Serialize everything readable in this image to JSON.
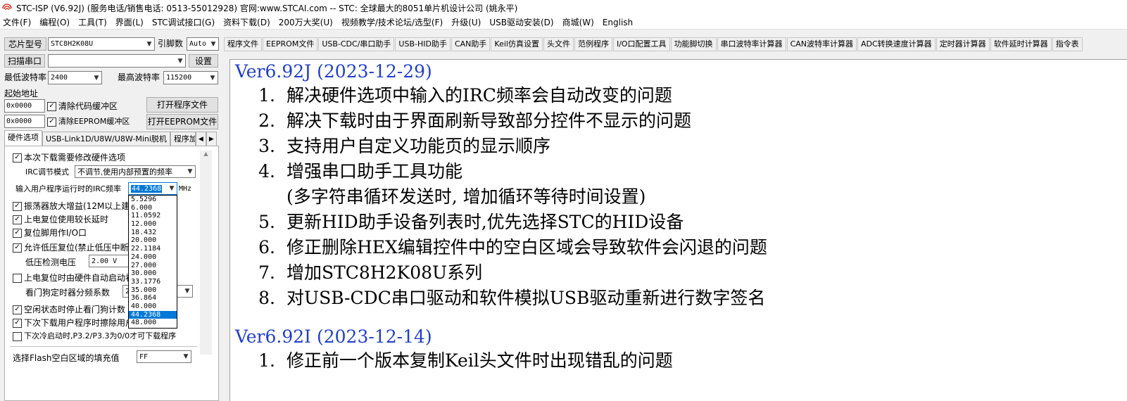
{
  "window": {
    "title": "STC-ISP (V6.92J) (服务电话/销售电话: 0513-55012928) 官网:www.STCAI.com  -- STC: 全球最大的8051单片机设计公司 (姚永平)"
  },
  "menu": [
    "文件(F)",
    "编程(O)",
    "工具(T)",
    "界面(L)",
    "STC调试接口(G)",
    "资料下载(D)",
    "200万大奖(U)",
    "视频教学/技术论坛/选型(F)",
    "升级(U)",
    "USB驱动安装(D)",
    "商城(W)",
    "English"
  ],
  "left": {
    "chip_model_btn": "芯片型号",
    "chip_model": "STC8H2K08U",
    "pin_count_label": "引脚数",
    "pin_count": "Auto",
    "scan_port_btn": "扫描串口",
    "port_value": "",
    "settings_btn": "设置",
    "min_baud_label": "最低波特率",
    "min_baud": "2400",
    "max_baud_label": "最高波特率",
    "max_baud": "115200",
    "start_addr_label": "起始地址",
    "code_addr": "0x0000",
    "clear_code_label": "清除代码缓冲区",
    "open_program_btn": "打开程序文件",
    "eeprom_addr": "0x0000",
    "clear_eeprom_label": "清除EEPROM缓冲区",
    "open_eeprom_btn": "打开EEPROM文件",
    "tabs": [
      "硬件选项",
      "USB-Link1D/U8W/U8W-Mini脱机",
      "程序加"
    ],
    "hw": {
      "modify_hw": "本次下载需要修改硬件选项",
      "irc_mode_label": "IRC调节模式",
      "irc_mode": "不调节,使用内部预置的频率",
      "irc_freq_label": "输入用户程序运行时的IRC频率",
      "irc_freq": "44.2368",
      "irc_unit": "MHz",
      "osc_gain": "振荡器放大增益(12M以上建议",
      "power_on_delay": "上电复位使用较长延时",
      "reset_pin_io": "复位脚用作I/O口",
      "low_volt_reset": "允许低压复位(禁止低压中断",
      "low_volt_label": "低压检测电压",
      "low_volt": "2.00 V",
      "wdt_auto": "上电复位时由硬件自动启动看",
      "wdt_div_label": "看门狗定时器分频系数",
      "wdt_div": "2",
      "idle_stop_wdt": "空闲状态时停止看门狗计数",
      "erase_user": "下次下载用户程序时擦除用户",
      "cold_boot": "下次冷启动时,P3.2/P3.3为0/0才可下载程序",
      "flash_fill_label": "选择Flash空白区域的填充值",
      "flash_fill": "FF"
    },
    "freq_options": [
      "5.5296",
      "6.000",
      "11.0592",
      "12.000",
      "18.432",
      "20.000",
      "22.1184",
      "24.000",
      "27.000",
      "30.000",
      "33.1776",
      "35.000",
      "36.864",
      "40.000",
      "44.2368",
      "48.000"
    ],
    "freq_selected_index": 14
  },
  "toolbar": [
    "程序文件",
    "EEPROM文件",
    "USB-CDC/串口助手",
    "USB-HID助手",
    "CAN助手",
    "Keil仿真设置",
    "头文件",
    "范例程序",
    "I/O口配置工具",
    "功能脚切换",
    "串口波特率计算器",
    "CAN波特率计算器",
    "ADC转换速度计算器",
    "定时器计算器",
    "软件延时计算器",
    "指令表"
  ],
  "release_notes": [
    {
      "version": "Ver6.92J (2023-12-29)",
      "items": [
        {
          "num": "1.",
          "lines": [
            "解决硬件选项中输入的IRC频率会自动改变的问题"
          ]
        },
        {
          "num": "2.",
          "lines": [
            "解决下载时由于界面刷新导致部分控件不显示的问题"
          ]
        },
        {
          "num": "3.",
          "lines": [
            "支持用户自定义功能页的显示顺序"
          ]
        },
        {
          "num": "4.",
          "lines": [
            "增强串口助手工具功能",
            "(多字符串循环发送时, 增加循环等待时间设置)"
          ]
        },
        {
          "num": "5.",
          "lines": [
            "更新HID助手设备列表时,优先选择STC的HID设备"
          ]
        },
        {
          "num": "6.",
          "lines": [
            "修正删除HEX编辑控件中的空白区域会导致软件会闪退的问题"
          ]
        },
        {
          "num": "7.",
          "lines": [
            "增加STC8H2K08U系列"
          ]
        },
        {
          "num": "8.",
          "lines": [
            "对USB-CDC串口驱动和软件模拟USB驱动重新进行数字签名"
          ]
        }
      ]
    },
    {
      "version": "Ver6.92I (2023-12-14)",
      "items": [
        {
          "num": "1.",
          "lines": [
            "修正前一个版本复制Keil头文件时出现错乱的问题"
          ]
        }
      ]
    }
  ]
}
